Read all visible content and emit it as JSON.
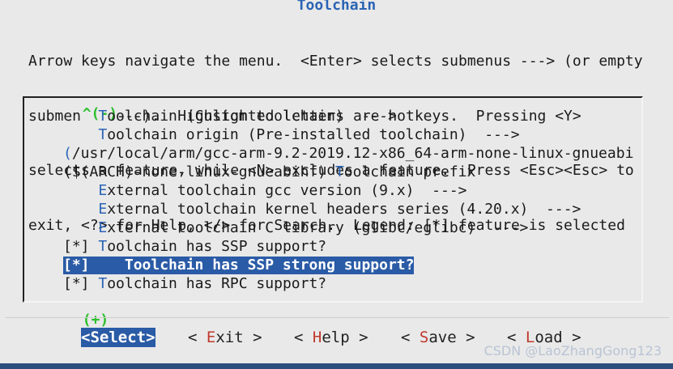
{
  "window": {
    "title": "Toolchain"
  },
  "help_lines": [
    "Arrow keys navigate the menu.  <Enter> selects submenus ---> (or empty",
    "submenus ----).  Highlighted letters are hotkeys.  Pressing <Y>",
    "selects a feature, while <N> excludes a feature.  Press <Esc><Esc> to",
    "exit, <?> for Help, </> for Search.  Legend: [*] feature is selected"
  ],
  "scroll_indicators": {
    "top": "^(-)",
    "bottom": "(+)"
  },
  "menu_items": [
    {
      "prefix": "    ",
      "hotkey": "T",
      "label": "oolchain (Custom toolchain)  --->"
    },
    {
      "prefix": "    ",
      "hotkey": "T",
      "label": "oolchain origin (Pre-installed toolchain)  --->"
    },
    {
      "prefix": "",
      "hotkey": "(",
      "label": "/usr/local/arm/gcc-arm-9.2-2019.12-x86_64-arm-none-linux-gnueabi"
    },
    {
      "prefix": "($(ARCH)-none-linux-gnueabihf) ",
      "hotkey": "T",
      "label": "oolchain prefix"
    },
    {
      "prefix": "    ",
      "hotkey": "E",
      "label": "xternal toolchain gcc version (9.x)  --->"
    },
    {
      "prefix": "    ",
      "hotkey": "E",
      "label": "xternal toolchain kernel headers series (4.20.x)  --->"
    },
    {
      "prefix": "    ",
      "hotkey": "E",
      "label": "xternal toolchain C library (glibc/eglibc)  --->"
    },
    {
      "prefix": "[*] ",
      "hotkey": "T",
      "label": "oolchain has SSP support?"
    },
    {
      "prefix": "[*]    ",
      "hotkey": "T",
      "label": "oolchain has SSP strong support?",
      "selected": true
    },
    {
      "prefix": "[*] ",
      "hotkey": "T",
      "label": "oolchain has RPC support?"
    }
  ],
  "buttons": [
    {
      "open": "<",
      "hotkey": "S",
      "rest": "elect",
      "close": ">",
      "active": true
    },
    {
      "open": "< ",
      "hotkey": "E",
      "rest": "xit",
      "close": " >"
    },
    {
      "open": "< ",
      "hotkey": "H",
      "rest": "elp",
      "close": " >"
    },
    {
      "open": "< ",
      "hotkey": "S",
      "rest": "ave",
      "close": " >"
    },
    {
      "open": "< ",
      "hotkey": "L",
      "rest": "oad",
      "close": " >"
    }
  ],
  "watermark": "CSDN @LaoZhangGong123",
  "colors": {
    "background": "#e9e9e9",
    "title": "#2a63b4",
    "hotkey_menu": "#2a63b4",
    "hotkey_button": "#c0392b",
    "selection": "#2a5ba6",
    "scroll_indicator": "#2bbf2b"
  }
}
